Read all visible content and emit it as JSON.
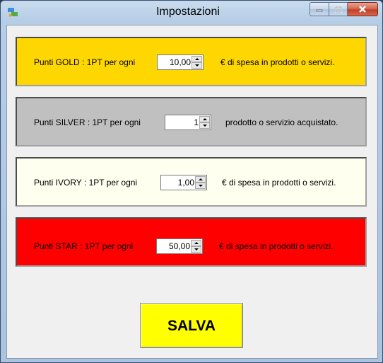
{
  "window": {
    "title": "Impostazioni",
    "app_icon": "settings-app-icon"
  },
  "colors": {
    "gold": "#ffd700",
    "silver": "#c0c0c0",
    "ivory": "#fffff0",
    "star": "#ff0000",
    "save": "#ffff00"
  },
  "panels": [
    {
      "id": "gold",
      "prefix": "Punti GOLD : 1PT per ogni",
      "value": "10,00",
      "suffix": "€ di spesa in prodotti o servizi."
    },
    {
      "id": "silver",
      "prefix": "Punti SILVER : 1PT per ogni",
      "value": "1",
      "suffix": "prodotto o servizio acquistato."
    },
    {
      "id": "ivory",
      "prefix": "Punti IVORY : 1PT per ogni",
      "value": "1,00",
      "suffix": "€ di spesa in prodotti o servizi."
    },
    {
      "id": "star",
      "prefix": "Punti STAR : 1PT per ogni",
      "value": "50,00",
      "suffix": "€ di spesa in prodotti o servizi."
    }
  ],
  "save_label": "SALVA"
}
